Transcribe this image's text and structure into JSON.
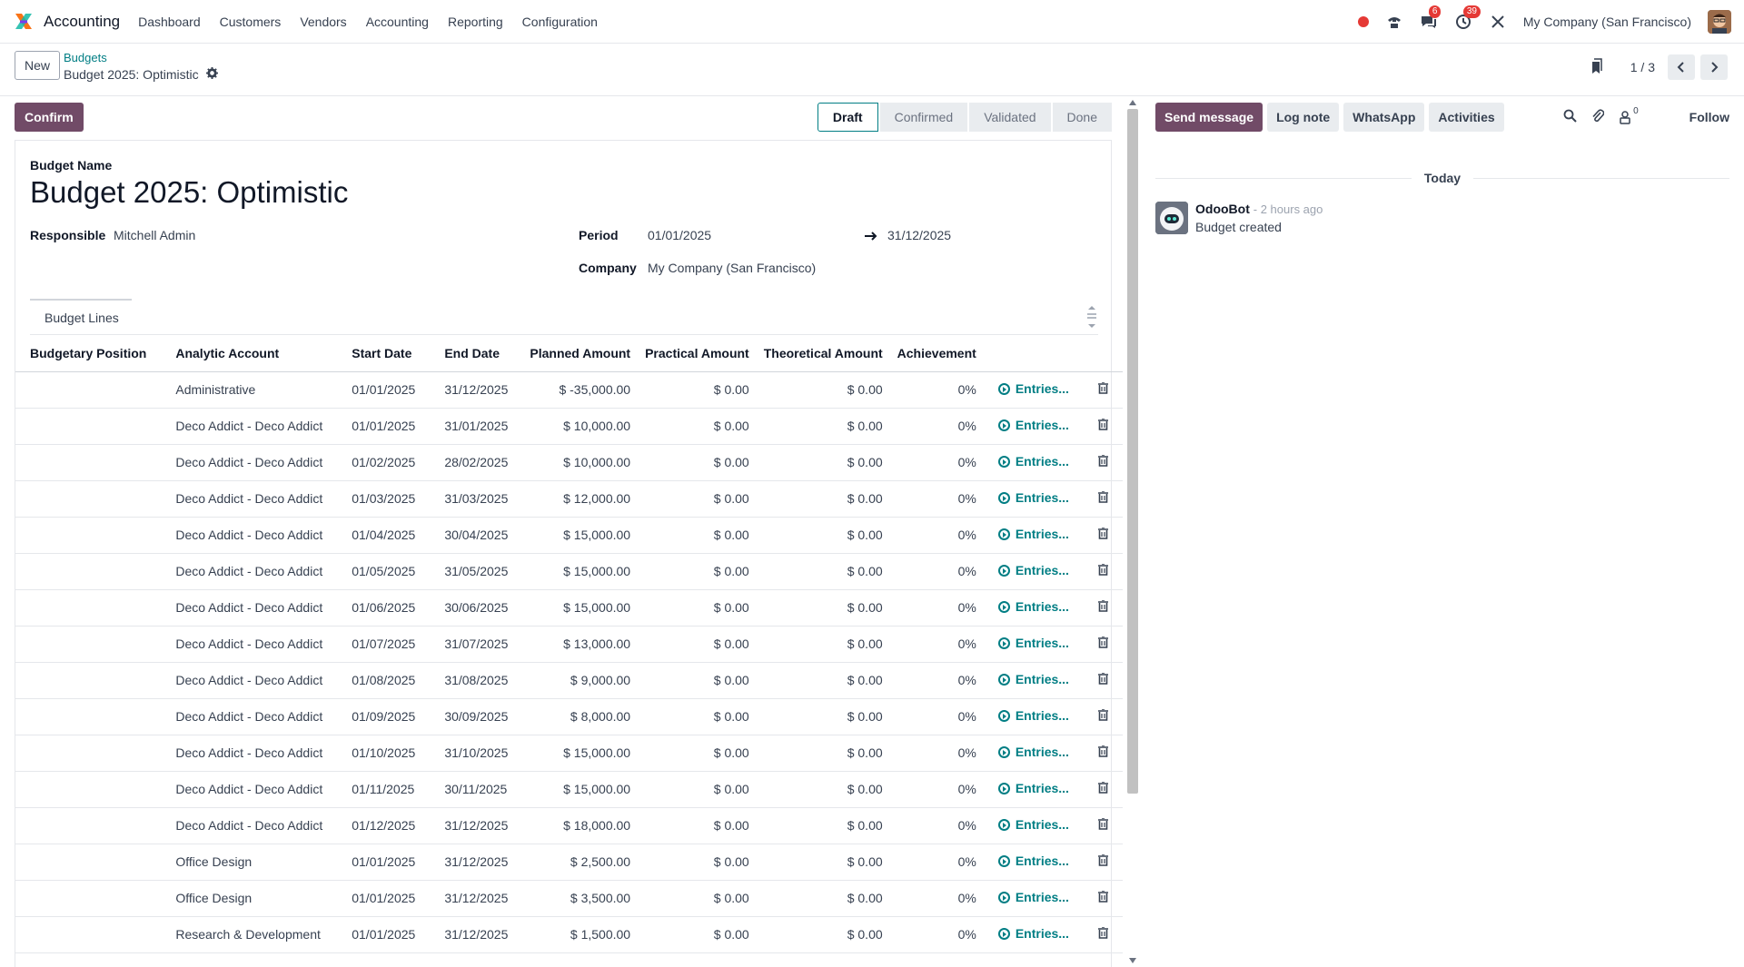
{
  "navbar": {
    "app_name": "Accounting",
    "menu": [
      "Dashboard",
      "Customers",
      "Vendors",
      "Accounting",
      "Reporting",
      "Configuration"
    ],
    "messages_badge": "6",
    "activities_badge": "39",
    "company": "My Company (San Francisco)"
  },
  "control": {
    "new_label": "New",
    "breadcrumb_parent": "Budgets",
    "breadcrumb_current": "Budget 2025: Optimistic",
    "pager": "1 / 3"
  },
  "form": {
    "confirm_label": "Confirm",
    "stages": [
      "Draft",
      "Confirmed",
      "Validated",
      "Done"
    ],
    "active_stage": "Draft",
    "name_label": "Budget Name",
    "name": "Budget 2025: Optimistic",
    "responsible_label": "Responsible",
    "responsible": "Mitchell Admin",
    "period_label": "Period",
    "period_start": "01/01/2025",
    "period_end": "31/12/2025",
    "company_label": "Company",
    "company": "My Company (San Francisco)",
    "tab_label": "Budget Lines"
  },
  "table": {
    "headers": [
      "Budgetary Position",
      "Analytic Account",
      "Start Date",
      "End Date",
      "Planned Amount",
      "Practical Amount",
      "Theoretical Amount",
      "Achievement"
    ],
    "entries_label": "Entries...",
    "rows": [
      {
        "position": "",
        "account": "Administrative",
        "start": "01/01/2025",
        "end": "31/12/2025",
        "planned": "$ -35,000.00",
        "practical": "$ 0.00",
        "theoretical": "$ 0.00",
        "achievement": "0%"
      },
      {
        "position": "",
        "account": "Deco Addict - Deco Addict",
        "start": "01/01/2025",
        "end": "31/01/2025",
        "planned": "$ 10,000.00",
        "practical": "$ 0.00",
        "theoretical": "$ 0.00",
        "achievement": "0%"
      },
      {
        "position": "",
        "account": "Deco Addict - Deco Addict",
        "start": "01/02/2025",
        "end": "28/02/2025",
        "planned": "$ 10,000.00",
        "practical": "$ 0.00",
        "theoretical": "$ 0.00",
        "achievement": "0%"
      },
      {
        "position": "",
        "account": "Deco Addict - Deco Addict",
        "start": "01/03/2025",
        "end": "31/03/2025",
        "planned": "$ 12,000.00",
        "practical": "$ 0.00",
        "theoretical": "$ 0.00",
        "achievement": "0%"
      },
      {
        "position": "",
        "account": "Deco Addict - Deco Addict",
        "start": "01/04/2025",
        "end": "30/04/2025",
        "planned": "$ 15,000.00",
        "practical": "$ 0.00",
        "theoretical": "$ 0.00",
        "achievement": "0%"
      },
      {
        "position": "",
        "account": "Deco Addict - Deco Addict",
        "start": "01/05/2025",
        "end": "31/05/2025",
        "planned": "$ 15,000.00",
        "practical": "$ 0.00",
        "theoretical": "$ 0.00",
        "achievement": "0%"
      },
      {
        "position": "",
        "account": "Deco Addict - Deco Addict",
        "start": "01/06/2025",
        "end": "30/06/2025",
        "planned": "$ 15,000.00",
        "practical": "$ 0.00",
        "theoretical": "$ 0.00",
        "achievement": "0%"
      },
      {
        "position": "",
        "account": "Deco Addict - Deco Addict",
        "start": "01/07/2025",
        "end": "31/07/2025",
        "planned": "$ 13,000.00",
        "practical": "$ 0.00",
        "theoretical": "$ 0.00",
        "achievement": "0%"
      },
      {
        "position": "",
        "account": "Deco Addict - Deco Addict",
        "start": "01/08/2025",
        "end": "31/08/2025",
        "planned": "$ 9,000.00",
        "practical": "$ 0.00",
        "theoretical": "$ 0.00",
        "achievement": "0%"
      },
      {
        "position": "",
        "account": "Deco Addict - Deco Addict",
        "start": "01/09/2025",
        "end": "30/09/2025",
        "planned": "$ 8,000.00",
        "practical": "$ 0.00",
        "theoretical": "$ 0.00",
        "achievement": "0%"
      },
      {
        "position": "",
        "account": "Deco Addict - Deco Addict",
        "start": "01/10/2025",
        "end": "31/10/2025",
        "planned": "$ 15,000.00",
        "practical": "$ 0.00",
        "theoretical": "$ 0.00",
        "achievement": "0%"
      },
      {
        "position": "",
        "account": "Deco Addict - Deco Addict",
        "start": "01/11/2025",
        "end": "30/11/2025",
        "planned": "$ 15,000.00",
        "practical": "$ 0.00",
        "theoretical": "$ 0.00",
        "achievement": "0%"
      },
      {
        "position": "",
        "account": "Deco Addict - Deco Addict",
        "start": "01/12/2025",
        "end": "31/12/2025",
        "planned": "$ 18,000.00",
        "practical": "$ 0.00",
        "theoretical": "$ 0.00",
        "achievement": "0%"
      },
      {
        "position": "",
        "account": "Office Design",
        "start": "01/01/2025",
        "end": "31/12/2025",
        "planned": "$ 2,500.00",
        "practical": "$ 0.00",
        "theoretical": "$ 0.00",
        "achievement": "0%"
      },
      {
        "position": "",
        "account": "Office Design",
        "start": "01/01/2025",
        "end": "31/12/2025",
        "planned": "$ 3,500.00",
        "practical": "$ 0.00",
        "theoretical": "$ 0.00",
        "achievement": "0%"
      },
      {
        "position": "",
        "account": "Research & Development",
        "start": "01/01/2025",
        "end": "31/12/2025",
        "planned": "$ 1,500.00",
        "practical": "$ 0.00",
        "theoretical": "$ 0.00",
        "achievement": "0%"
      }
    ]
  },
  "chatter": {
    "send_message": "Send message",
    "log_note": "Log note",
    "whatsapp": "WhatsApp",
    "activities": "Activities",
    "followers_count": "0",
    "follow": "Follow",
    "date_separator": "Today",
    "message": {
      "author": "OdooBot",
      "time": "- 2 hours ago",
      "body": "Budget created"
    }
  },
  "colors": {
    "primary": "#714b67",
    "link": "#017e84",
    "badge": "#e53935"
  }
}
